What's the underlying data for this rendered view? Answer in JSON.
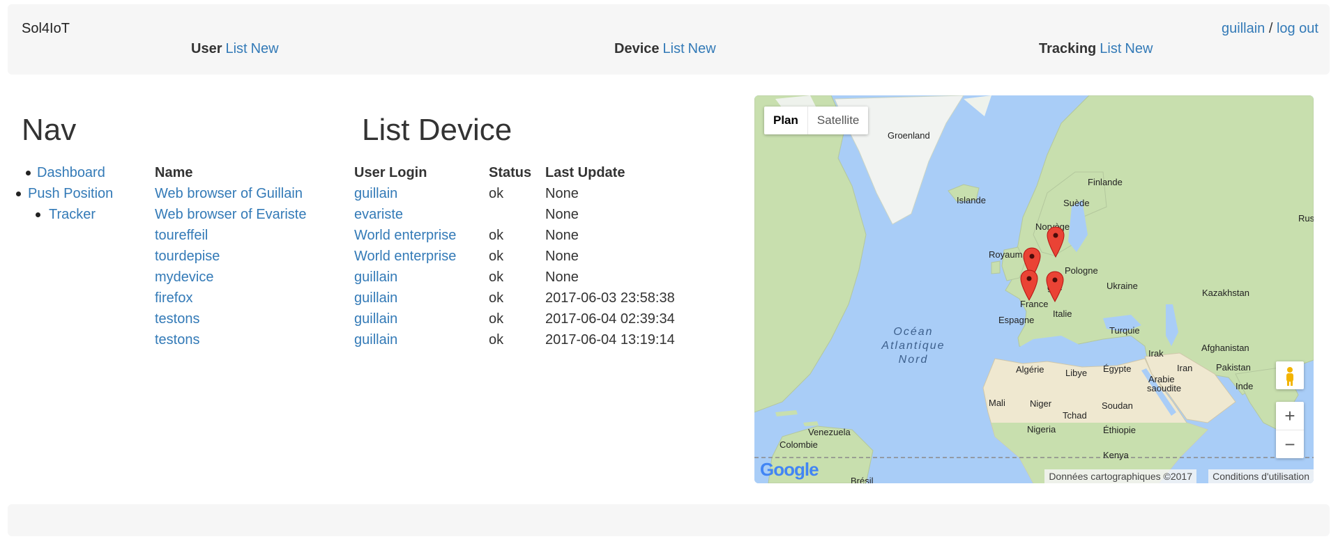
{
  "navbar": {
    "brand": "Sol4IoT",
    "username": "guillain",
    "separator": " / ",
    "logout": "log out",
    "groups": [
      {
        "title": "User",
        "list": "List",
        "new": "New"
      },
      {
        "title": "Device",
        "list": "List",
        "new": "New"
      },
      {
        "title": "Tracking",
        "list": "List",
        "new": "New"
      }
    ]
  },
  "sidebar": {
    "title": "Nav",
    "items": [
      "Dashboard",
      "Push Position",
      "Tracker"
    ]
  },
  "devices": {
    "title": "List Device",
    "columns": [
      "Name",
      "User Login",
      "Status",
      "Last Update"
    ],
    "rows": [
      {
        "name": "Web browser of Guillain",
        "login": "guillain",
        "status": "ok",
        "update": "None"
      },
      {
        "name": "Web browser of Evariste",
        "login": "evariste",
        "status": "",
        "update": "None"
      },
      {
        "name": "toureffeil",
        "login": "World enterprise",
        "status": "ok",
        "update": "None"
      },
      {
        "name": "tourdepise",
        "login": "World enterprise",
        "status": "ok",
        "update": "None"
      },
      {
        "name": "mydevice",
        "login": "guillain",
        "status": "ok",
        "update": "None"
      },
      {
        "name": "firefox",
        "login": "guillain",
        "status": "ok",
        "update": "2017-06-03 23:58:38"
      },
      {
        "name": "testons",
        "login": "guillain",
        "status": "ok",
        "update": "2017-06-04 02:39:34"
      },
      {
        "name": "testons",
        "login": "guillain",
        "status": "ok",
        "update": "2017-06-04 13:19:14"
      }
    ]
  },
  "map": {
    "plan": "Plan",
    "satellite": "Satellite",
    "labels": {
      "groenland": "Groenland",
      "islande": "Islande",
      "finlande": "Finlande",
      "suede": "Suède",
      "norvege": "Norvège",
      "royaume": "Royaum",
      "pologne": "Pologne",
      "ukraine": "Ukraine",
      "russ": "Russ",
      "kazakhstan": "Kazakhstan",
      "france": "France",
      "espagne": "Espagne",
      "italie": "Italie",
      "turquie": "Turquie",
      "irak": "Irak",
      "afghanistan": "Afghanistan",
      "iran": "Iran",
      "pakistan": "Pakistan",
      "algerie": "Algérie",
      "libye": "Libye",
      "egypte": "Égypte",
      "arabie": "Arabie",
      "saoudite": "saoudite",
      "inde": "Inde",
      "mali": "Mali",
      "niger": "Niger",
      "soudan": "Soudan",
      "tchad": "Tchad",
      "nigeria": "Nigeria",
      "ethiopie": "Éthiopie",
      "kenya": "Kenya",
      "venezuela": "Venezuela",
      "colombie": "Colombie",
      "bresil": "Brésil",
      "gne": "gne"
    },
    "ocean": [
      "Océan",
      "Atlantique",
      "Nord"
    ],
    "google": "Google",
    "attribution": "Données cartographiques ©2017",
    "terms": "Conditions d'utilisation",
    "zoom_in": "+",
    "zoom_out": "−",
    "colors": {
      "water": "#a9cdf7",
      "land": "#c8dfae",
      "ice": "#f1f3f1",
      "desert": "#efe8d0",
      "marker": "#ea4335"
    }
  }
}
